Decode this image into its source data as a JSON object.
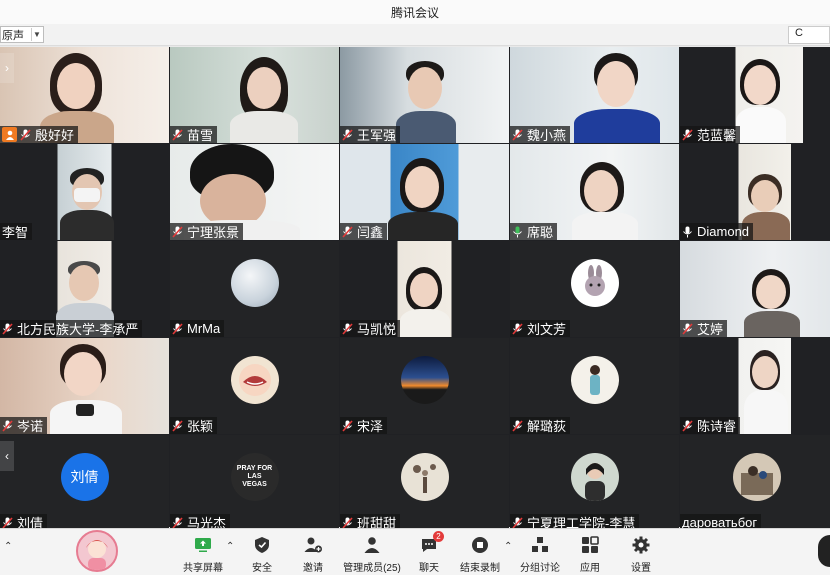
{
  "window": {
    "title": "腾讯会议"
  },
  "top_toolbar": {
    "audio_mode": "原声",
    "right_box_text": "C"
  },
  "participants": [
    {
      "name": "殷好好",
      "host": true
    },
    {
      "name": "苗雪"
    },
    {
      "name": "王军强"
    },
    {
      "name": "魏小燕"
    },
    {
      "name": "范蓝馨"
    },
    {
      "name": "李智"
    },
    {
      "name": "宁理张景"
    },
    {
      "name": "闫鑫"
    },
    {
      "name": "席聪",
      "speaking": true
    },
    {
      "name": "Diamond"
    },
    {
      "name": "北方民族大学-李承严"
    },
    {
      "name": "MrMa"
    },
    {
      "name": "马凯悦"
    },
    {
      "name": "刘文芳"
    },
    {
      "name": "艾婷"
    },
    {
      "name": "岑诺"
    },
    {
      "name": "张颖"
    },
    {
      "name": "宋泽"
    },
    {
      "name": "解璐荻"
    },
    {
      "name": "陈诗睿"
    },
    {
      "name": "刘倩",
      "avatar_text": "刘倩"
    },
    {
      "name": "马光杰",
      "avatar_text": "PRAY FOR LAS VEGAS"
    },
    {
      "name": "班甜甜"
    },
    {
      "name": "宁夏理工学院-李慧"
    },
    {
      "name": "дароватьбог"
    }
  ],
  "bottom_toolbar": {
    "share": "共享屏幕",
    "security": "安全",
    "invite": "邀请",
    "members": "管理成员(25)",
    "chat": "聊天",
    "chat_badge": "2",
    "end_record": "结束录制",
    "breakout": "分组讨论",
    "apps": "应用",
    "settings": "设置"
  },
  "colors": {
    "speaking_outline": "#3fbf5a",
    "host_badge": "#f07a22",
    "share_green": "#2faa4b",
    "liu_qian_avatar": "#1a73e8"
  }
}
